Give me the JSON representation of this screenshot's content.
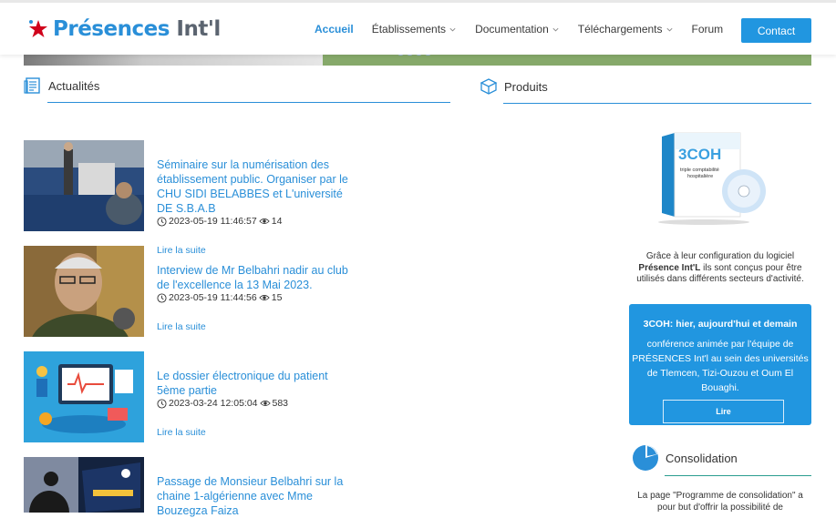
{
  "header": {
    "logo_part1": "Présences",
    "logo_part2": "Int'l",
    "nav": [
      {
        "label": "Accueil",
        "dropdown": false,
        "active": true
      },
      {
        "label": "Établissements",
        "dropdown": true,
        "active": false
      },
      {
        "label": "Documentation",
        "dropdown": true,
        "active": false
      },
      {
        "label": "Téléchargements",
        "dropdown": true,
        "active": false
      },
      {
        "label": "Forum",
        "dropdown": false,
        "active": false
      }
    ],
    "contact_label": "Contact"
  },
  "news_section": {
    "title": "Actualités",
    "icon": "newspaper-icon",
    "items": [
      {
        "title": "Séminaire sur la numérisation des établissement public. Organiser par le CHU SIDI BELABBES et L'université DE S.B.A.B",
        "date": "2023-05-19 11:46:57",
        "views": "14",
        "read_more": "Lire la suite"
      },
      {
        "title": "Interview de Mr Belbahri nadir au club de l'excellence la 13 Mai 2023.",
        "date": "2023-05-19 11:44:56",
        "views": "15",
        "read_more": "Lire la suite"
      },
      {
        "title": "Le dossier électronique du patient 5ème partie",
        "date": "2023-03-24 12:05:04",
        "views": "583",
        "read_more": "Lire la suite"
      },
      {
        "title": "Passage de Monsieur Belbahri sur la chaine 1-algérienne avec Mme Bouzegza Faiza",
        "date": "",
        "views": "",
        "read_more": ""
      }
    ]
  },
  "products_section": {
    "title": "Produits",
    "icon": "box-icon",
    "product_box_title": "3COH",
    "product_box_subtitle": "triple comptabilité hospitalière",
    "description_pre": "Grâce à leur configuration du logiciel ",
    "description_bold": "Présence Int'L",
    "description_post": " ils sont conçus pour être utilisés dans différents secteurs d'activité.",
    "card": {
      "title": "3COH: hier, aujourd'hui et demain",
      "text": "conférence animée par l'équipe de PRÉSENCES Int'l au sein des universités de Tlemcen, Tizi-Ouzou et Oum El Bouaghi.",
      "button": "Lire",
      "color": "#2196e0"
    },
    "consolidation_title": "Consolidation",
    "consolidation_text": "La page \"Programme de consolidation\" a pour but d'offrir la possibilité de"
  },
  "colors": {
    "accent": "#2a8fd8",
    "button": "#2196e0"
  }
}
